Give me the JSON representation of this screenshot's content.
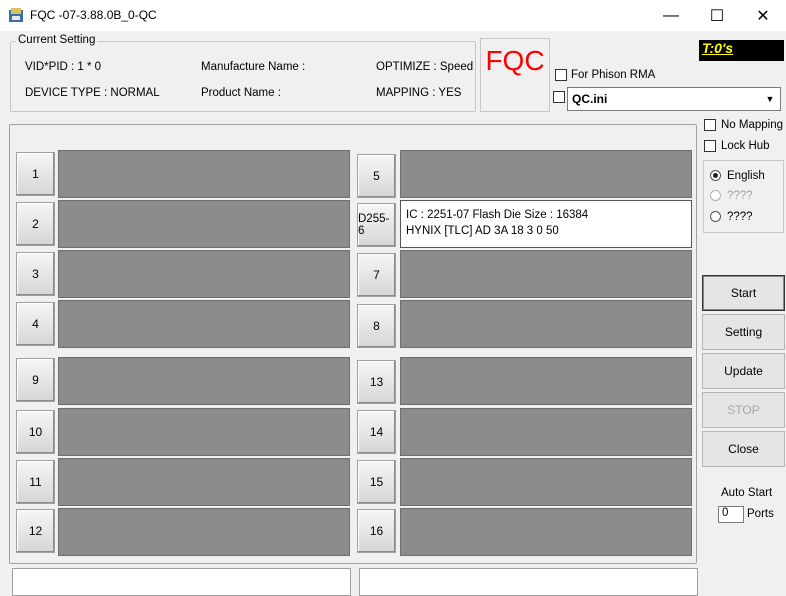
{
  "window": {
    "title": "FQC -07-3.88.0B_0-QC",
    "icon": "app-icon",
    "minimize_glyph": "—",
    "maximize_glyph": "☐",
    "close_glyph": "✕"
  },
  "current_setting": {
    "legend": "Current Setting",
    "vid_pid": "VID*PID :    1 *    0",
    "device_type": "DEVICE TYPE : NORMAL",
    "manufacture_name": "Manufacture Name :",
    "product_name": "Product Name :",
    "optimize": "OPTIMIZE : Speed",
    "mapping": "MAPPING : YES"
  },
  "logo": "FQC",
  "timer": "T:0's",
  "options": {
    "for_phison_rma": "For Phison RMA",
    "ini_file": "QC.ini",
    "no_mapping": "No Mapping",
    "lock_hub": "Lock Hub"
  },
  "language": {
    "english": "English",
    "lang2": "????",
    "lang3": "????"
  },
  "ports": {
    "p1": "1",
    "p2": "2",
    "p3": "3",
    "p4": "4",
    "p5": "5",
    "p6": "D255-6",
    "p7": "7",
    "p8": "8",
    "p9": "9",
    "p10": "10",
    "p11": "11",
    "p12": "12",
    "p13": "13",
    "p14": "14",
    "p15": "15",
    "p16": "16",
    "p6_line1": "IC : 2251-07  Flash Die Size : 16384",
    "p6_line2": "HYNIX [TLC] AD 3A 18 3 0 50"
  },
  "buttons": {
    "start": "Start",
    "setting": "Setting",
    "update": "Update",
    "stop": "STOP",
    "close": "Close"
  },
  "auto_start": {
    "label": "Auto Start",
    "value": "0",
    "ports_label": "Ports"
  }
}
